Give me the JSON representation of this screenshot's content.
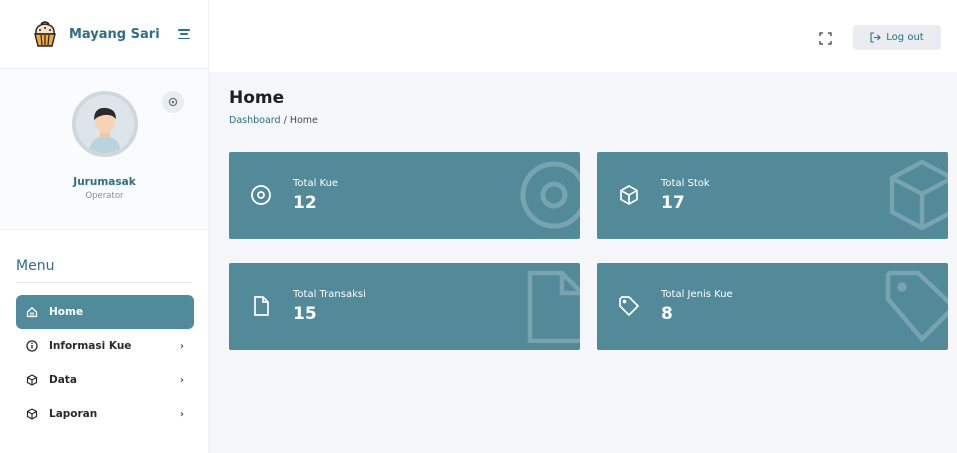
{
  "brand": {
    "name": "Mayang Sari"
  },
  "profile": {
    "name": "Jurumasak",
    "role": "Operator"
  },
  "menu": {
    "title": "Menu",
    "items": [
      {
        "label": "Home",
        "icon": "home-icon",
        "active": true
      },
      {
        "label": "Informasi Kue",
        "icon": "info-icon",
        "chevron": "›"
      },
      {
        "label": "Data",
        "icon": "cube-icon",
        "chevron": "›"
      },
      {
        "label": "Laporan",
        "icon": "cube-icon",
        "chevron": "›"
      }
    ]
  },
  "topbar": {
    "logout_label": "Log out"
  },
  "page": {
    "title": "Home",
    "breadcrumb": {
      "root": "Dashboard",
      "separator": "/",
      "current": "Home"
    }
  },
  "cards": [
    {
      "label": "Total Kue",
      "value": "12",
      "icon": "disc-icon"
    },
    {
      "label": "Total Stok",
      "value": "17",
      "icon": "cube-icon"
    },
    {
      "label": "Total Transaksi",
      "value": "15",
      "icon": "file-icon"
    },
    {
      "label": "Total Jenis Kue",
      "value": "8",
      "icon": "tag-icon"
    }
  ],
  "colors": {
    "accent": "#528a99",
    "brand": "#2d6f86",
    "active_nav": "#4f8b9a"
  }
}
